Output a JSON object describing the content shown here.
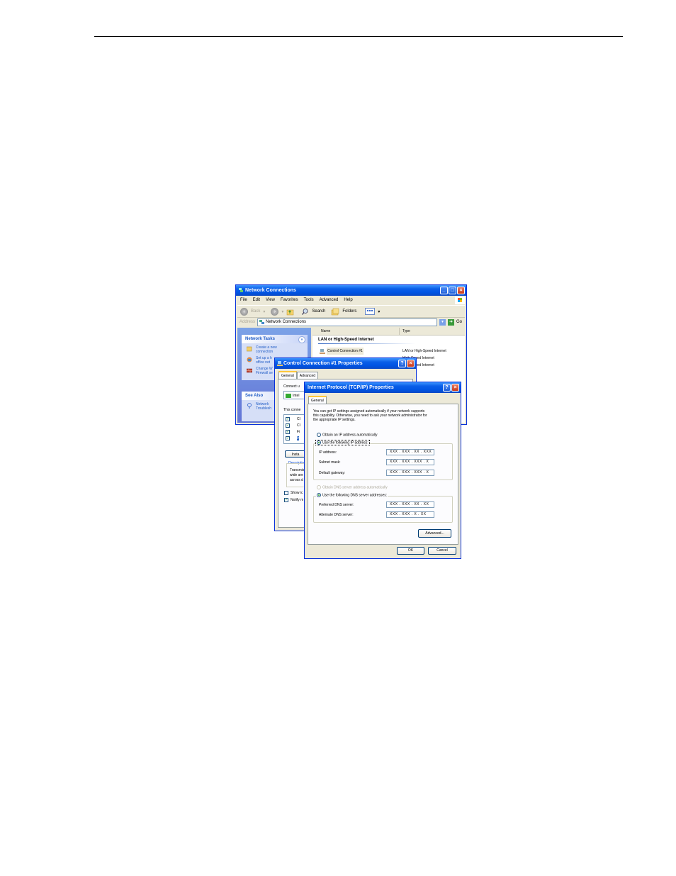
{
  "network_window": {
    "title": "Network Connections",
    "menu": [
      "File",
      "Edit",
      "View",
      "Favorites",
      "Tools",
      "Advanced",
      "Help"
    ],
    "toolbar": {
      "back": "Back",
      "search": "Search",
      "folders": "Folders"
    },
    "address": {
      "label": "Address",
      "value": "Network Connections",
      "go": "Go"
    },
    "network_tasks": {
      "header": "Network Tasks",
      "items": [
        "Create a new",
        "connection",
        "Set up a h",
        "office net",
        "Change W",
        "Firewall se"
      ]
    },
    "see_also": {
      "header": "See Also",
      "items": [
        "Network",
        "Troublesh"
      ]
    },
    "list": {
      "col_name": "Name",
      "col_type": "Type",
      "group": "LAN or High-Speed Internet",
      "rows": [
        {
          "name": "Control Connection #1",
          "type": "LAN or High-Speed Internet"
        },
        {
          "name": "",
          "type": "High-Speed Internet"
        },
        {
          "name": "",
          "type": "High-Speed Internet"
        }
      ]
    }
  },
  "connection_dialog": {
    "title": "Control Connection #1 Properties",
    "tabs": [
      "General",
      "Advanced"
    ],
    "connect_using": "Connect u",
    "adapter": "Intel",
    "this_connection": "This conne",
    "items": [
      "Cl",
      "Cl",
      "Fi",
      "Ir"
    ],
    "install": "Insta",
    "description": "Descriptio",
    "desc_lines": [
      "Transmis",
      "wide are",
      "across d"
    ],
    "show_icon": "Show ic",
    "notify": "Notify m"
  },
  "tcpip_dialog": {
    "title": "Internet Protocol (TCP/IP) Properties",
    "tab": "General",
    "intro": [
      "You can get IP settings assigned automatically if your network supports",
      "this capability. Otherwise, you need to ask your network administrator for",
      "the appropriate IP settings."
    ],
    "obtain_ip": "Obtain an IP address automatically",
    "use_ip": "Use the following IP address:",
    "ip_label": "IP address:",
    "ip_value": "XXX . XXX . XX . XXX",
    "subnet_label": "Subnet mask:",
    "subnet_value": "XXX . XXX . XXX . X",
    "gateway_label": "Default gateway:",
    "gateway_value": "XXX . XXX . XXX . X",
    "obtain_dns": "Obtain DNS server address automatically",
    "use_dns": "Use the following DNS server addresses:",
    "pref_dns_label": "Preferred DNS server:",
    "pref_dns_value": "XXX . XXX . XX . XX",
    "alt_dns_label": "Alternate DNS server:",
    "alt_dns_value": "XXX . XXX . X . XX",
    "advanced": "Advanced...",
    "ok": "OK",
    "cancel": "Cancel"
  }
}
